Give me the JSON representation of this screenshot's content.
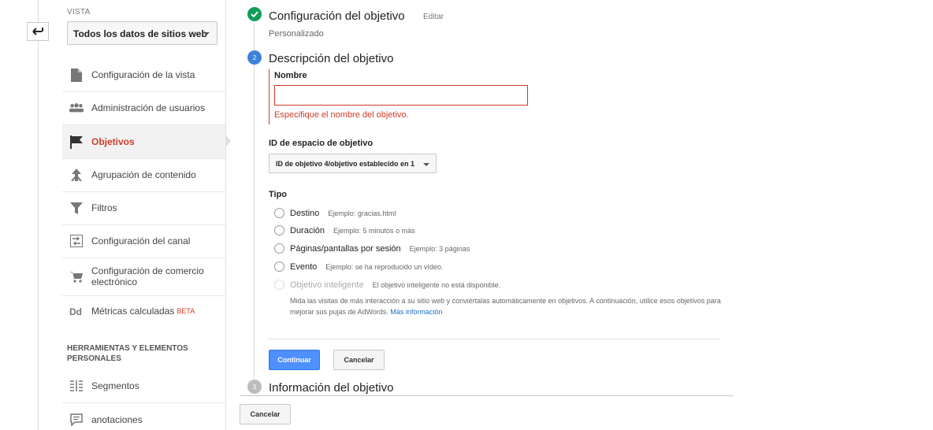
{
  "sidebar": {
    "view_label": "VISTA",
    "view_selected": "Todos los datos de sitios web",
    "items": [
      {
        "label": "Configuración de la vista",
        "icon": "document-icon"
      },
      {
        "label": "Administración de usuarios",
        "icon": "users-icon"
      },
      {
        "label": "Objetivos",
        "icon": "flag-icon",
        "active": true
      },
      {
        "label": "Agrupación de contenido",
        "icon": "grouping-icon"
      },
      {
        "label": "Filtros",
        "icon": "filter-icon"
      },
      {
        "label": "Configuración del canal",
        "icon": "channel-icon"
      },
      {
        "label": "Configuración de comercio electrónico",
        "icon": "cart-icon"
      },
      {
        "label": "Métricas calculadas",
        "icon": "dd-icon",
        "badge": "BETA"
      }
    ],
    "section_title": "HERRAMIENTAS Y ELEMENTOS PERSONALES",
    "tools": [
      {
        "label": "Segmentos",
        "icon": "segments-icon"
      },
      {
        "label": "anotaciones",
        "icon": "annotations-icon"
      }
    ]
  },
  "steps": {
    "step1": {
      "title": "Configuración del objetivo",
      "edit": "Editar",
      "subtitle": "Personalizado"
    },
    "step2": {
      "number": "2",
      "title": "Descripción del objetivo"
    },
    "step3": {
      "number": "3",
      "title": "Información del objetivo"
    }
  },
  "form": {
    "name_label": "Nombre",
    "name_value": "",
    "name_error": "Especifique el nombre del objetivo.",
    "slot_label": "ID de espacio de objetivo",
    "slot_value": "ID de objetivo 4/objetivo establecido en 1",
    "type_label": "Tipo",
    "types": [
      {
        "label": "Destino",
        "example": "Ejemplo: gracias.html"
      },
      {
        "label": "Duración",
        "example": "Ejemplo: 5 minutos o más"
      },
      {
        "label": "Páginas/pantallas por sesión",
        "example": "Ejemplo: 3 páginas"
      },
      {
        "label": "Evento",
        "example": "Ejemplo: se ha reproducido un vídeo."
      },
      {
        "label": "Objetivo inteligente",
        "example": "El objetivo inteligente no está disponible.",
        "disabled": true
      }
    ],
    "smart_description": "Mida las visitas de más interacción a su sitio web y conviértalas automáticamente en objetivos. A continuación, utilice esos objetivos para mejorar sus pujas de AdWords.",
    "smart_link": "Más información",
    "continue_label": "Continuar",
    "cancel_label": "Cancelar"
  },
  "footer": {
    "cancel_label": "Cancelar"
  },
  "colors": {
    "accent_red": "#d03b25",
    "primary_blue": "#4d90fe",
    "success_green": "#0f9d58",
    "link_blue": "#1a6fc4"
  }
}
